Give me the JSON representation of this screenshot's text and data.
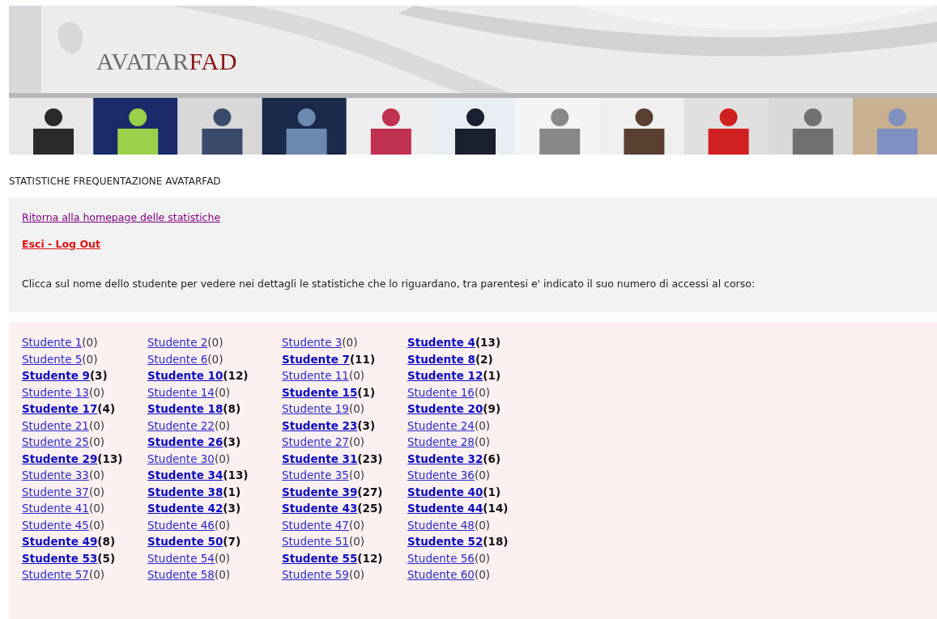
{
  "header": {
    "logo": {
      "main": "AVATAR",
      "accent": "FAD"
    }
  },
  "page_title": "STATISTICHE FREQUENTAZIONE AVATARFAD",
  "links": [
    {
      "kind": "visited",
      "text": "Ritorna alla homepage delle statistiche"
    },
    {
      "kind": "logout",
      "text": "Esci - Log Out"
    }
  ],
  "instructions": "Clicca sul nome dello studente per vedere nei dettagli le statistiche che lo riguardano, tra parentesi e' indicato il suo numero di accessi al corso:",
  "students": [
    {
      "name": "Studente 1",
      "count": "(0)",
      "active": false
    },
    {
      "name": "Studente 2",
      "count": "(0)",
      "active": false
    },
    {
      "name": "Studente 3",
      "count": "(0)",
      "active": false
    },
    {
      "name": "Studente 4",
      "count": "(13)",
      "active": true
    },
    {
      "name": "Studente 5",
      "count": "(0)",
      "active": false
    },
    {
      "name": "Studente 6",
      "count": "(0)",
      "active": false
    },
    {
      "name": "Studente 7",
      "count": "(11)",
      "active": true
    },
    {
      "name": "Studente 8",
      "count": "(2)",
      "active": true
    },
    {
      "name": "Studente 9",
      "count": "(3)",
      "active": true
    },
    {
      "name": "Studente 10",
      "count": "(12)",
      "active": true
    },
    {
      "name": "Studente 11",
      "count": "(0)",
      "active": false
    },
    {
      "name": "Studente 12",
      "count": "(1)",
      "active": true
    },
    {
      "name": "Studente 13",
      "count": "(0)",
      "active": false
    },
    {
      "name": "Studente 14",
      "count": "(0)",
      "active": false
    },
    {
      "name": "Studente 15",
      "count": "(1)",
      "active": true
    },
    {
      "name": "Studente 16",
      "count": "(0)",
      "active": false
    },
    {
      "name": "Studente 17",
      "count": "(4)",
      "active": true
    },
    {
      "name": "Studente 18",
      "count": "(8)",
      "active": true
    },
    {
      "name": "Studente 19",
      "count": "(0)",
      "active": false
    },
    {
      "name": "Studente 20",
      "count": "(9)",
      "active": true
    },
    {
      "name": "Studente 21",
      "count": "(0)",
      "active": false
    },
    {
      "name": "Studente 22",
      "count": "(0)",
      "active": false
    },
    {
      "name": "Studente 23",
      "count": "(3)",
      "active": true
    },
    {
      "name": "Studente 24",
      "count": "(0)",
      "active": false
    },
    {
      "name": "Studente 25",
      "count": "(0)",
      "active": false
    },
    {
      "name": "Studente 26",
      "count": "(3)",
      "active": true
    },
    {
      "name": "Studente 27",
      "count": "(0)",
      "active": false
    },
    {
      "name": "Studente 28",
      "count": "(0)",
      "active": false
    },
    {
      "name": "Studente 29",
      "count": "(13)",
      "active": true
    },
    {
      "name": "Studente 30",
      "count": "(0)",
      "active": false
    },
    {
      "name": "Studente 31",
      "count": "(23)",
      "active": true
    },
    {
      "name": "Studente 32",
      "count": "(6)",
      "active": true
    },
    {
      "name": "Studente 33",
      "count": "(0)",
      "active": false
    },
    {
      "name": "Studente 34",
      "count": "(13)",
      "active": true
    },
    {
      "name": "Studente 35",
      "count": "(0)",
      "active": false
    },
    {
      "name": "Studente 36",
      "count": "(0)",
      "active": false
    },
    {
      "name": "Studente 37",
      "count": "(0)",
      "active": false
    },
    {
      "name": "Studente 38",
      "count": "(1)",
      "active": true
    },
    {
      "name": "Studente 39",
      "count": "(27)",
      "active": true
    },
    {
      "name": "Studente 40",
      "count": "(1)",
      "active": true
    },
    {
      "name": "Studente 41",
      "count": "(0)",
      "active": false
    },
    {
      "name": "Studente 42",
      "count": "(3)",
      "active": true
    },
    {
      "name": "Studente 43",
      "count": "(25)",
      "active": true
    },
    {
      "name": "Studente 44",
      "count": "(14)",
      "active": true
    },
    {
      "name": "Studente 45",
      "count": "(0)",
      "active": false
    },
    {
      "name": "Studente 46",
      "count": "(0)",
      "active": false
    },
    {
      "name": "Studente 47",
      "count": "(0)",
      "active": false
    },
    {
      "name": "Studente 48",
      "count": "(0)",
      "active": false
    },
    {
      "name": "Studente 49",
      "count": "(8)",
      "active": true
    },
    {
      "name": "Studente 50",
      "count": "(7)",
      "active": true
    },
    {
      "name": "Studente 51",
      "count": "(0)",
      "active": false
    },
    {
      "name": "Studente 52",
      "count": "(18)",
      "active": true
    },
    {
      "name": "Studente 53",
      "count": "(5)",
      "active": true
    },
    {
      "name": "Studente 54",
      "count": "(0)",
      "active": false
    },
    {
      "name": "Studente 55",
      "count": "(12)",
      "active": true
    },
    {
      "name": "Studente 56",
      "count": "(0)",
      "active": false
    },
    {
      "name": "Studente 57",
      "count": "(0)",
      "active": false
    },
    {
      "name": "Studente 58",
      "count": "(0)",
      "active": false
    },
    {
      "name": "Studente 59",
      "count": "(0)",
      "active": false
    },
    {
      "name": "Studente 60",
      "count": "(0)",
      "active": false
    }
  ]
}
